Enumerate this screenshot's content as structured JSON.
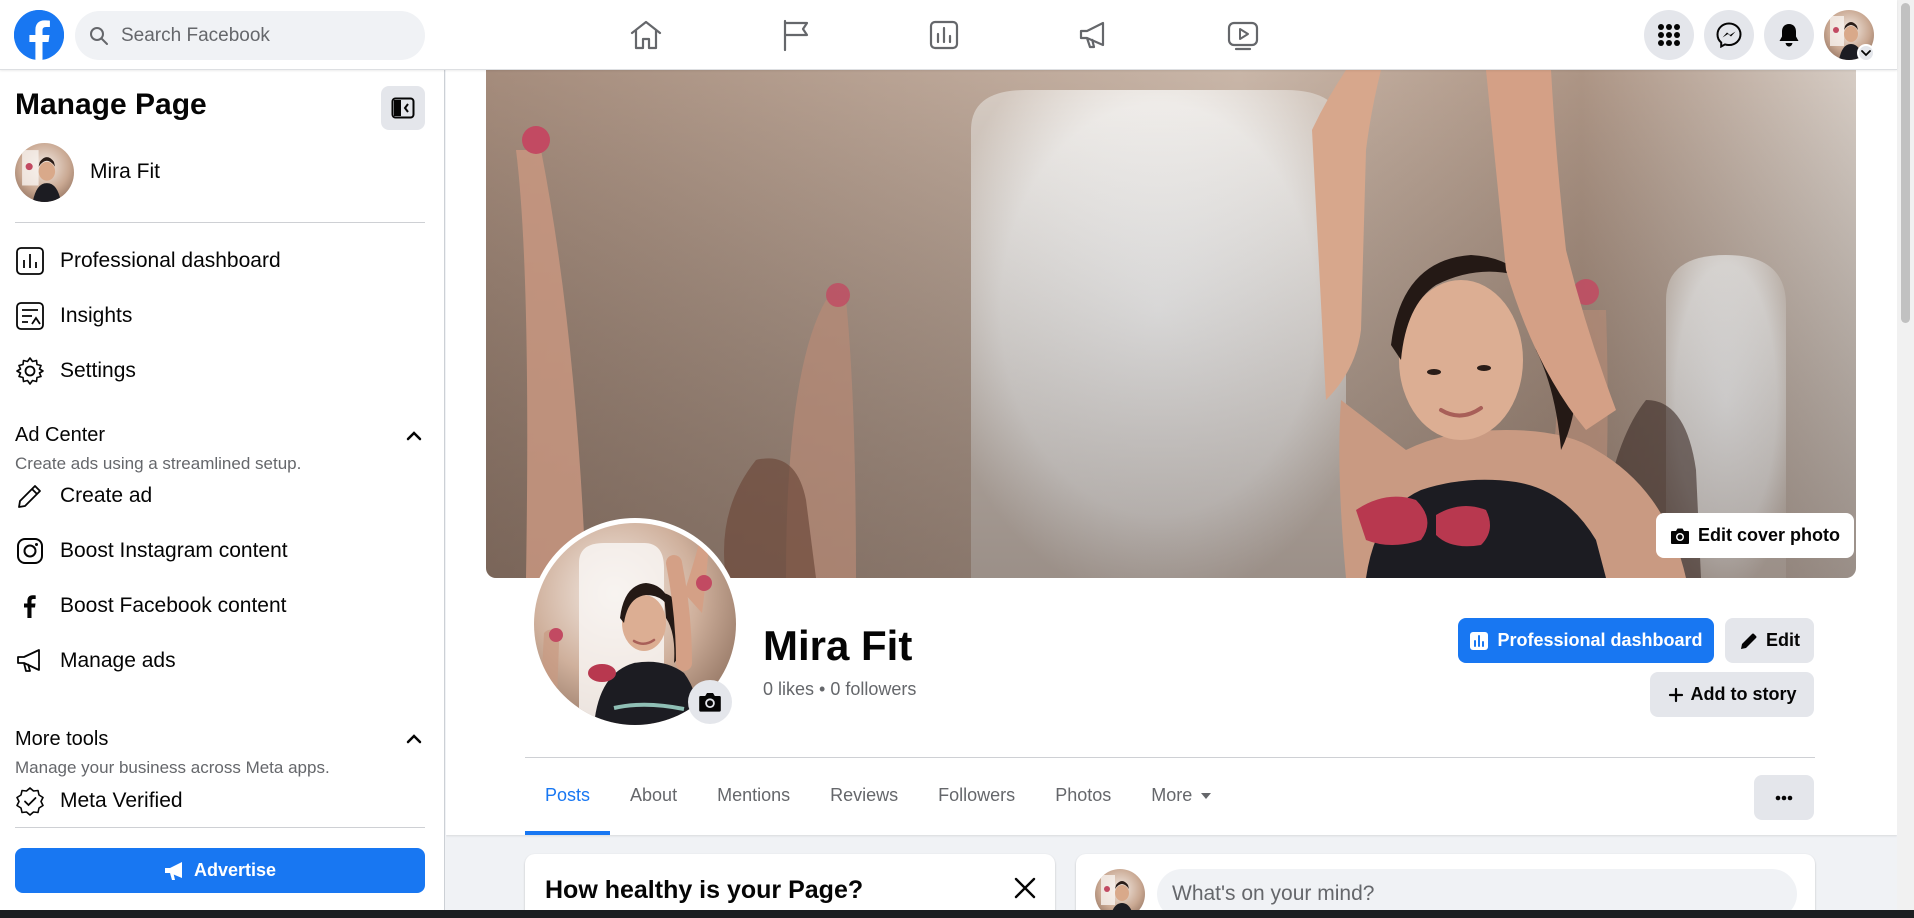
{
  "topbar": {
    "search_placeholder": "Search Facebook",
    "nav_icons": [
      "home-icon",
      "flag-icon",
      "insights-icon",
      "megaphone-icon",
      "video-icon"
    ],
    "right_buttons": [
      "menu-grid-icon",
      "messenger-icon",
      "bell-icon"
    ]
  },
  "sidebar": {
    "title": "Manage Page",
    "page_name": "Mira Fit",
    "items": [
      {
        "label": "Professional dashboard",
        "icon": "dashboard-icon"
      },
      {
        "label": "Insights",
        "icon": "insights-icon"
      },
      {
        "label": "Settings",
        "icon": "gear-icon"
      }
    ],
    "ad_center": {
      "title": "Ad Center",
      "subtitle": "Create ads using a streamlined setup.",
      "items": [
        {
          "label": "Create ad",
          "icon": "pencil-icon"
        },
        {
          "label": "Boost Instagram content",
          "icon": "instagram-icon"
        },
        {
          "label": "Boost Facebook content",
          "icon": "facebook-icon"
        },
        {
          "label": "Manage ads",
          "icon": "megaphone-icon"
        }
      ]
    },
    "more_tools": {
      "title": "More tools",
      "subtitle": "Manage your business across Meta apps.",
      "items": [
        {
          "label": "Meta Verified",
          "icon": "verified-badge-icon"
        }
      ]
    },
    "advertise_label": "Advertise"
  },
  "profile": {
    "edit_cover_label": "Edit cover photo",
    "name": "Mira Fit",
    "stats": "0 likes • 0 followers",
    "professional_dashboard_label": "Professional dashboard",
    "edit_label": "Edit",
    "add_story_label": "Add to story",
    "tabs": [
      "Posts",
      "About",
      "Mentions",
      "Reviews",
      "Followers",
      "Photos",
      "More"
    ],
    "active_tab": "Posts"
  },
  "health_card": {
    "title": "How healthy is your Page?"
  },
  "composer": {
    "placeholder": "What's on your mind?"
  },
  "colors": {
    "brand_blue": "#1877f2",
    "background": "#f0f2f5",
    "button_grey": "#e4e6eb",
    "secondary_text": "#65676b"
  }
}
